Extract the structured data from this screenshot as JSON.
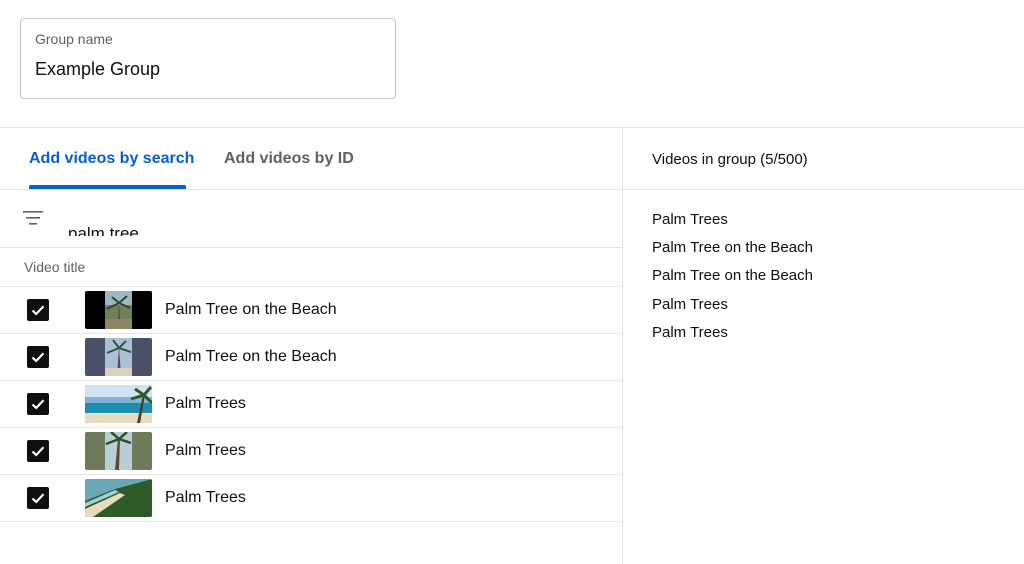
{
  "group_name": {
    "label": "Group name",
    "value": "Example Group"
  },
  "tabs": [
    {
      "label": "Add videos by search",
      "active": true
    },
    {
      "label": "Add videos by ID",
      "active": false
    }
  ],
  "search": {
    "filter_icon": "filter-icon",
    "query": "palm tree"
  },
  "table": {
    "column_header": "Video title",
    "rows": [
      {
        "checked": true,
        "thumbnail": "palm-tree-vertical-dark",
        "title": "Palm Tree on the Beach"
      },
      {
        "checked": true,
        "thumbnail": "palm-tree-vertical-blue",
        "title": "Palm Tree on the Beach"
      },
      {
        "checked": true,
        "thumbnail": "beach-ocean",
        "title": "Palm Trees"
      },
      {
        "checked": true,
        "thumbnail": "palm-tree-sky",
        "title": "Palm Trees"
      },
      {
        "checked": true,
        "thumbnail": "aerial-coastline",
        "title": "Palm Trees"
      }
    ]
  },
  "group_panel": {
    "header": "Videos in group (5/500)",
    "items": [
      "Palm Trees",
      "Palm Tree on the Beach",
      "Palm Tree on the Beach",
      "Palm Trees",
      "Palm Trees"
    ]
  },
  "colors": {
    "accent": "#065fd4",
    "divider": "#e5e5e5",
    "checkbox": "#0f0f0f"
  }
}
